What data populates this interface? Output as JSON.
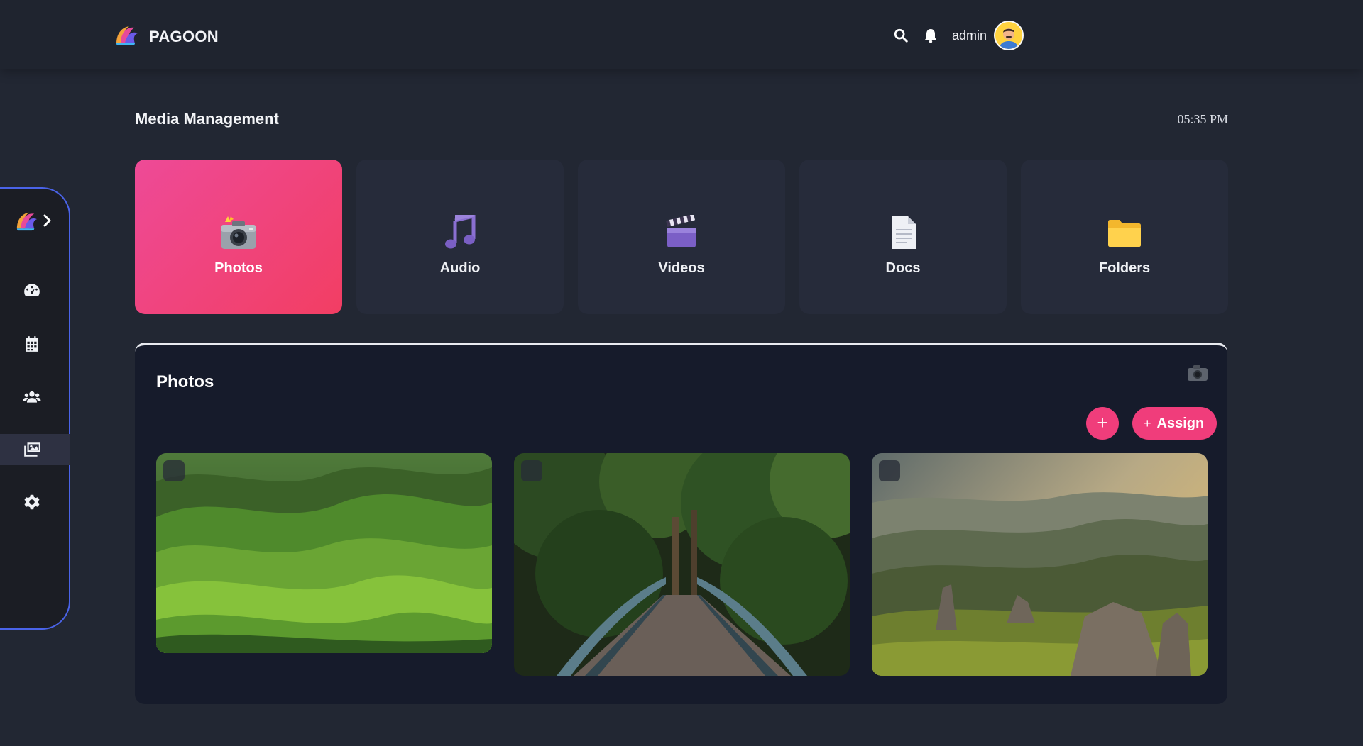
{
  "app": {
    "brand_name": "PAGOON",
    "accent_color": "#f03d7b",
    "sidebar_border_color": "#4a63e8"
  },
  "header": {
    "username": "admin",
    "icons": [
      "search-icon",
      "bell-icon"
    ]
  },
  "sidebar": {
    "items": [
      {
        "name": "dashboard",
        "icon": "gauge-icon",
        "active": false
      },
      {
        "name": "calendar",
        "icon": "calendar-icon",
        "active": false
      },
      {
        "name": "users",
        "icon": "users-icon",
        "active": false
      },
      {
        "name": "media",
        "icon": "media-icon",
        "active": true
      },
      {
        "name": "settings",
        "icon": "gear-icon",
        "active": false
      }
    ]
  },
  "main": {
    "title": "Media Management",
    "time": "05:35 PM",
    "categories": [
      {
        "label": "Photos",
        "icon": "camera-flash-icon",
        "active": true
      },
      {
        "label": "Audio",
        "icon": "music-note-icon",
        "active": false
      },
      {
        "label": "Videos",
        "icon": "clapperboard-icon",
        "active": false
      },
      {
        "label": "Docs",
        "icon": "document-icon",
        "active": false
      },
      {
        "label": "Folders",
        "icon": "folder-icon",
        "active": false
      }
    ]
  },
  "photos_panel": {
    "title": "Photos",
    "add_label": "+",
    "assign_plus": "+",
    "assign_label": "Assign",
    "photos": [
      {
        "subject": "green rolling hills"
      },
      {
        "subject": "forest footbridge"
      },
      {
        "subject": "mountain valley sunrise"
      }
    ]
  }
}
